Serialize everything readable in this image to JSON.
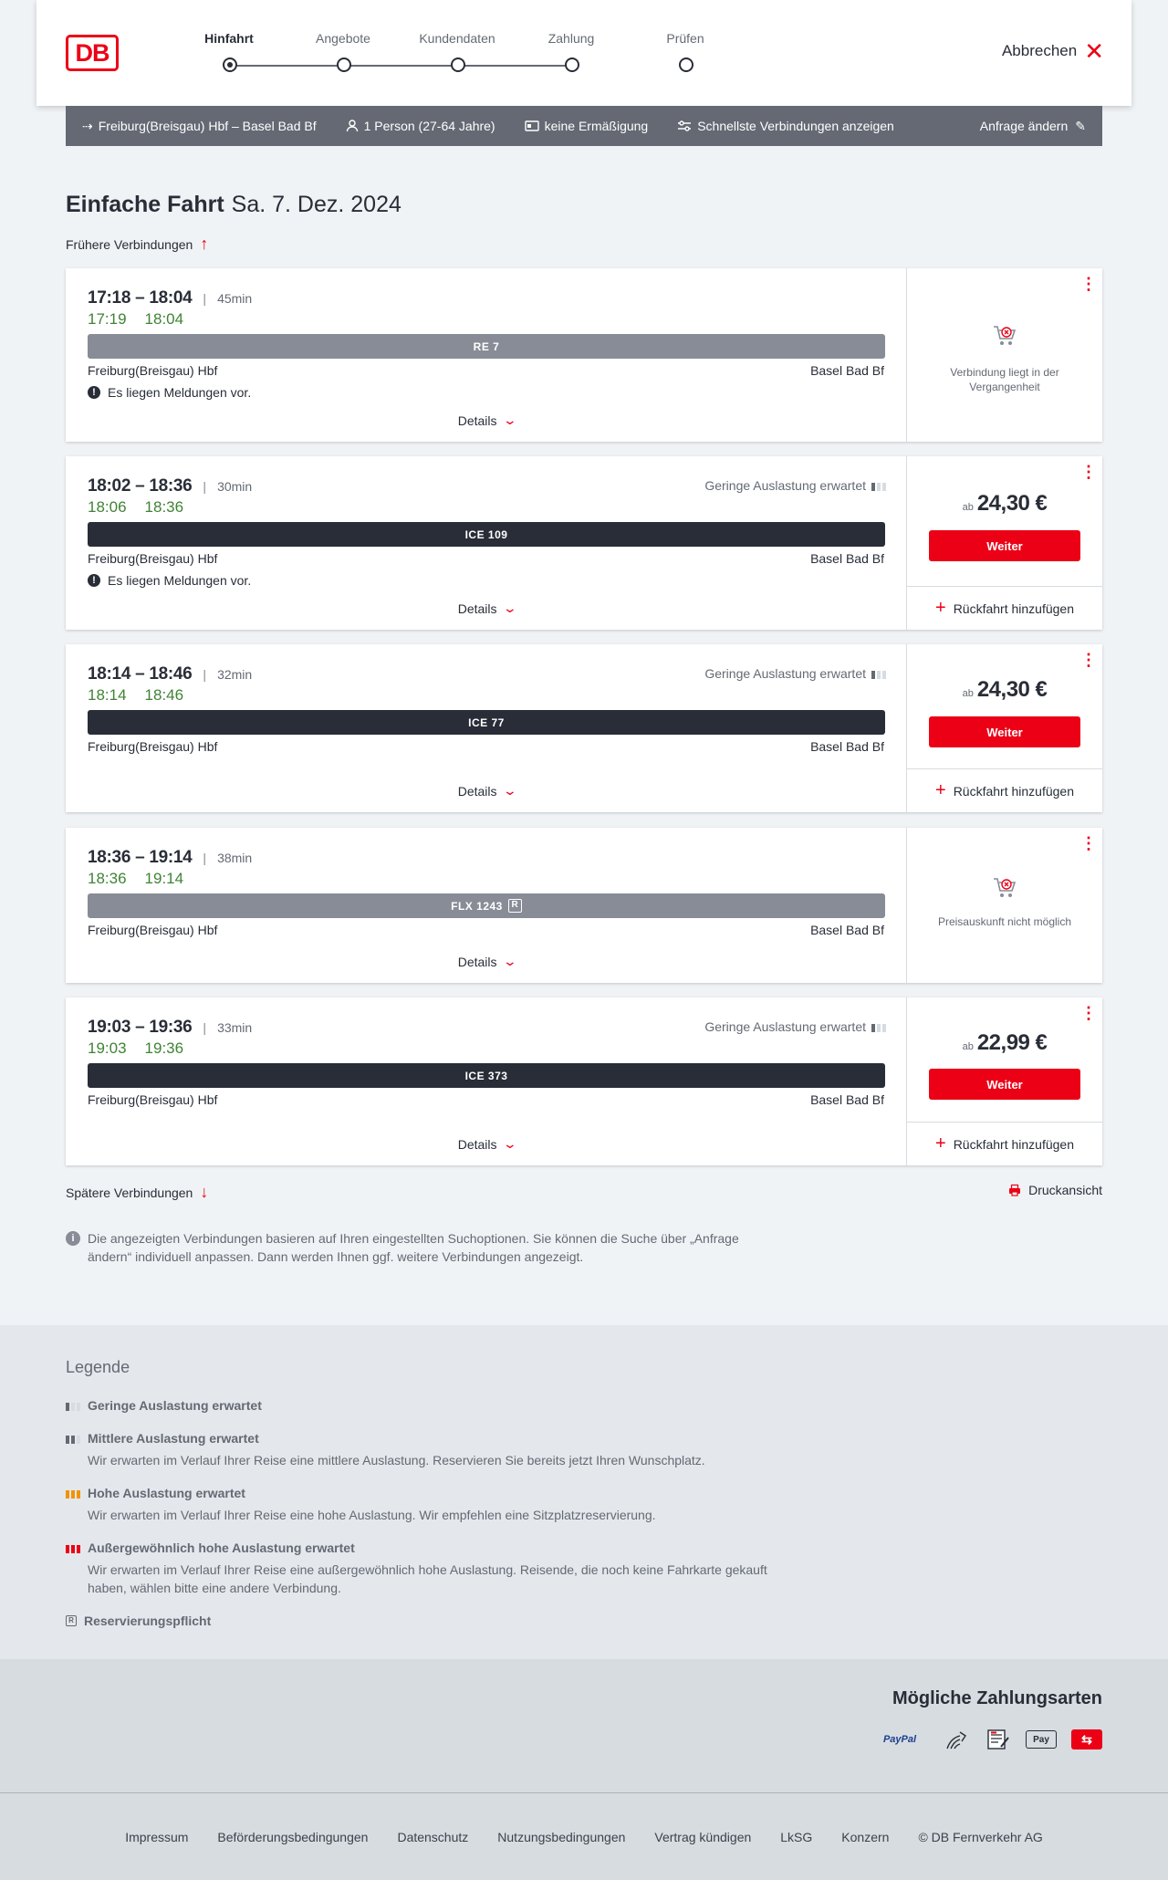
{
  "header": {
    "logo": "DB",
    "steps": [
      "Hinfahrt",
      "Angebote",
      "Kundendaten",
      "Zahlung",
      "Prüfen"
    ],
    "cancel_label": "Abbrechen"
  },
  "searchbar": {
    "route": "Freiburg(Breisgau) Hbf – Basel Bad Bf",
    "persons": "1 Person (27-64 Jahre)",
    "discount": "keine Ermäßigung",
    "fastest": "Schnellste Verbindungen anzeigen",
    "change": "Anfrage ändern"
  },
  "title": {
    "type": "Einfache Fahrt",
    "date": "Sa. 7. Dez. 2024"
  },
  "earlier_label": "Frühere Verbindungen",
  "later_label": "Spätere Verbindungen",
  "print_label": "Druckansicht",
  "details_label": "Details",
  "weiter_label": "Weiter",
  "rueck_label": "Rückfahrt hinzufügen",
  "ab_label": "ab",
  "connections": [
    {
      "time": "17:18 – 18:04",
      "duration": "45min",
      "rt_dep": "17:19",
      "rt_arr": "18:04",
      "train": "RE 7",
      "style": "gray",
      "from": "Freiburg(Breisgau) Hbf",
      "to": "Basel Bad Bf",
      "message": "Es liegen Meldungen vor.",
      "unavailable": "Verbindung liegt in der Vergangenheit"
    },
    {
      "time": "18:02 – 18:36",
      "duration": "30min",
      "rt_dep": "18:06",
      "rt_arr": "18:36",
      "train": "ICE 109",
      "style": "dark",
      "from": "Freiburg(Breisgau) Hbf",
      "to": "Basel Bad Bf",
      "message": "Es liegen Meldungen vor.",
      "auslastung": "Geringe Auslastung erwartet",
      "price": "24,30 €"
    },
    {
      "time": "18:14 – 18:46",
      "duration": "32min",
      "rt_dep": "18:14",
      "rt_arr": "18:46",
      "train": "ICE 77",
      "style": "dark",
      "from": "Freiburg(Breisgau) Hbf",
      "to": "Basel Bad Bf",
      "auslastung": "Geringe Auslastung erwartet",
      "price": "24,30 €"
    },
    {
      "time": "18:36 – 19:14",
      "duration": "38min",
      "rt_dep": "18:36",
      "rt_arr": "19:14",
      "train": "FLX 1243",
      "train_badge": "R",
      "style": "gray",
      "from": "Freiburg(Breisgau) Hbf",
      "to": "Basel Bad Bf",
      "unavailable": "Preisauskunft nicht möglich"
    },
    {
      "time": "19:03 – 19:36",
      "duration": "33min",
      "rt_dep": "19:03",
      "rt_arr": "19:36",
      "train": "ICE 373",
      "style": "dark",
      "from": "Freiburg(Breisgau) Hbf",
      "to": "Basel Bad Bf",
      "auslastung": "Geringe Auslastung erwartet",
      "price": "22,99 €"
    }
  ],
  "info_text": "Die angezeigten Verbindungen basieren auf Ihren eingestellten Suchoptionen. Sie können die Suche über „Anfrage ändern“ individuell anpassen. Dann werden Ihnen ggf. weitere Verbindungen angezeigt.",
  "legend": {
    "title": "Legende",
    "items": [
      {
        "title": "Geringe Auslastung erwartet",
        "desc": ""
      },
      {
        "title": "Mittlere Auslastung erwartet",
        "desc": "Wir erwarten im Verlauf Ihrer Reise eine mittlere Auslastung. Reservieren Sie bereits jetzt Ihren Wunschplatz."
      },
      {
        "title": "Hohe Auslastung erwartet",
        "desc": "Wir erwarten im Verlauf Ihrer Reise eine hohe Auslastung. Wir empfehlen eine Sitzplatzreservierung."
      },
      {
        "title": "Außergewöhnlich hohe Auslastung erwartet",
        "desc": "Wir erwarten im Verlauf Ihrer Reise eine außergewöhnlich hohe Auslastung. Reisende, die noch keine Fahrkarte gekauft haben, wählen bitte eine andere Verbindung."
      },
      {
        "title": "Reservierungspflicht",
        "desc": ""
      }
    ]
  },
  "payment": {
    "title": "Mögliche Zahlungsarten",
    "paypal": "PayPal"
  },
  "footer": [
    "Impressum",
    "Beförderungsbedingungen",
    "Datenschutz",
    "Nutzungsbedingungen",
    "Vertrag kündigen",
    "LkSG",
    "Konzern",
    "© DB Fernverkehr AG"
  ],
  "colors": {
    "db_red": "#ec0016",
    "realtime_green": "#408335",
    "bar_dark": "#282d37",
    "bar_gray": "#878c96"
  }
}
